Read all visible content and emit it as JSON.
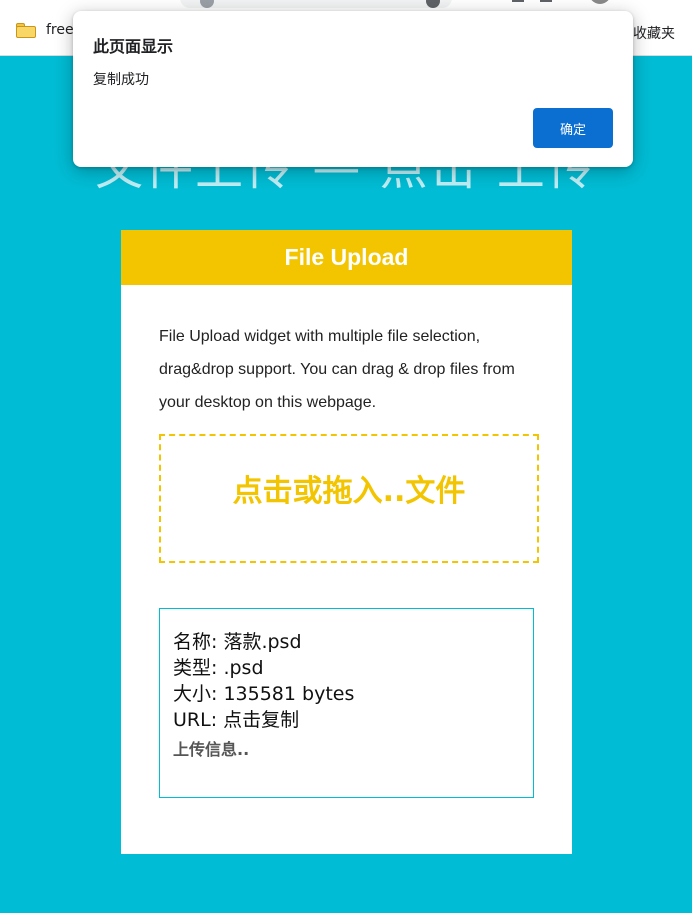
{
  "browser": {
    "bookmarks_bar": {
      "folder_label": "free",
      "other_bookmarks_label": "收藏夹"
    }
  },
  "page": {
    "title_ghost": "文件上传 — 点击 上传"
  },
  "card": {
    "header_title": "File Upload",
    "description": "File Upload widget with multiple file selection, drag&drop support. You can drag & drop files from your desktop on this webpage.",
    "dropzone_text": "点击或拖入..文件",
    "file_info": {
      "name_line": "名称: 落款.psd",
      "type_line": "类型: .psd",
      "size_line": "大小: 135581 bytes",
      "url_line": "URL: 点击复制",
      "status": "上传信息.."
    }
  },
  "alert": {
    "title": "此页面显示",
    "message": "复制成功",
    "ok_label": "确定"
  },
  "colors": {
    "page_background": "#00bcd4",
    "accent_yellow": "#f2c500",
    "button_blue": "#0b6fd1"
  }
}
